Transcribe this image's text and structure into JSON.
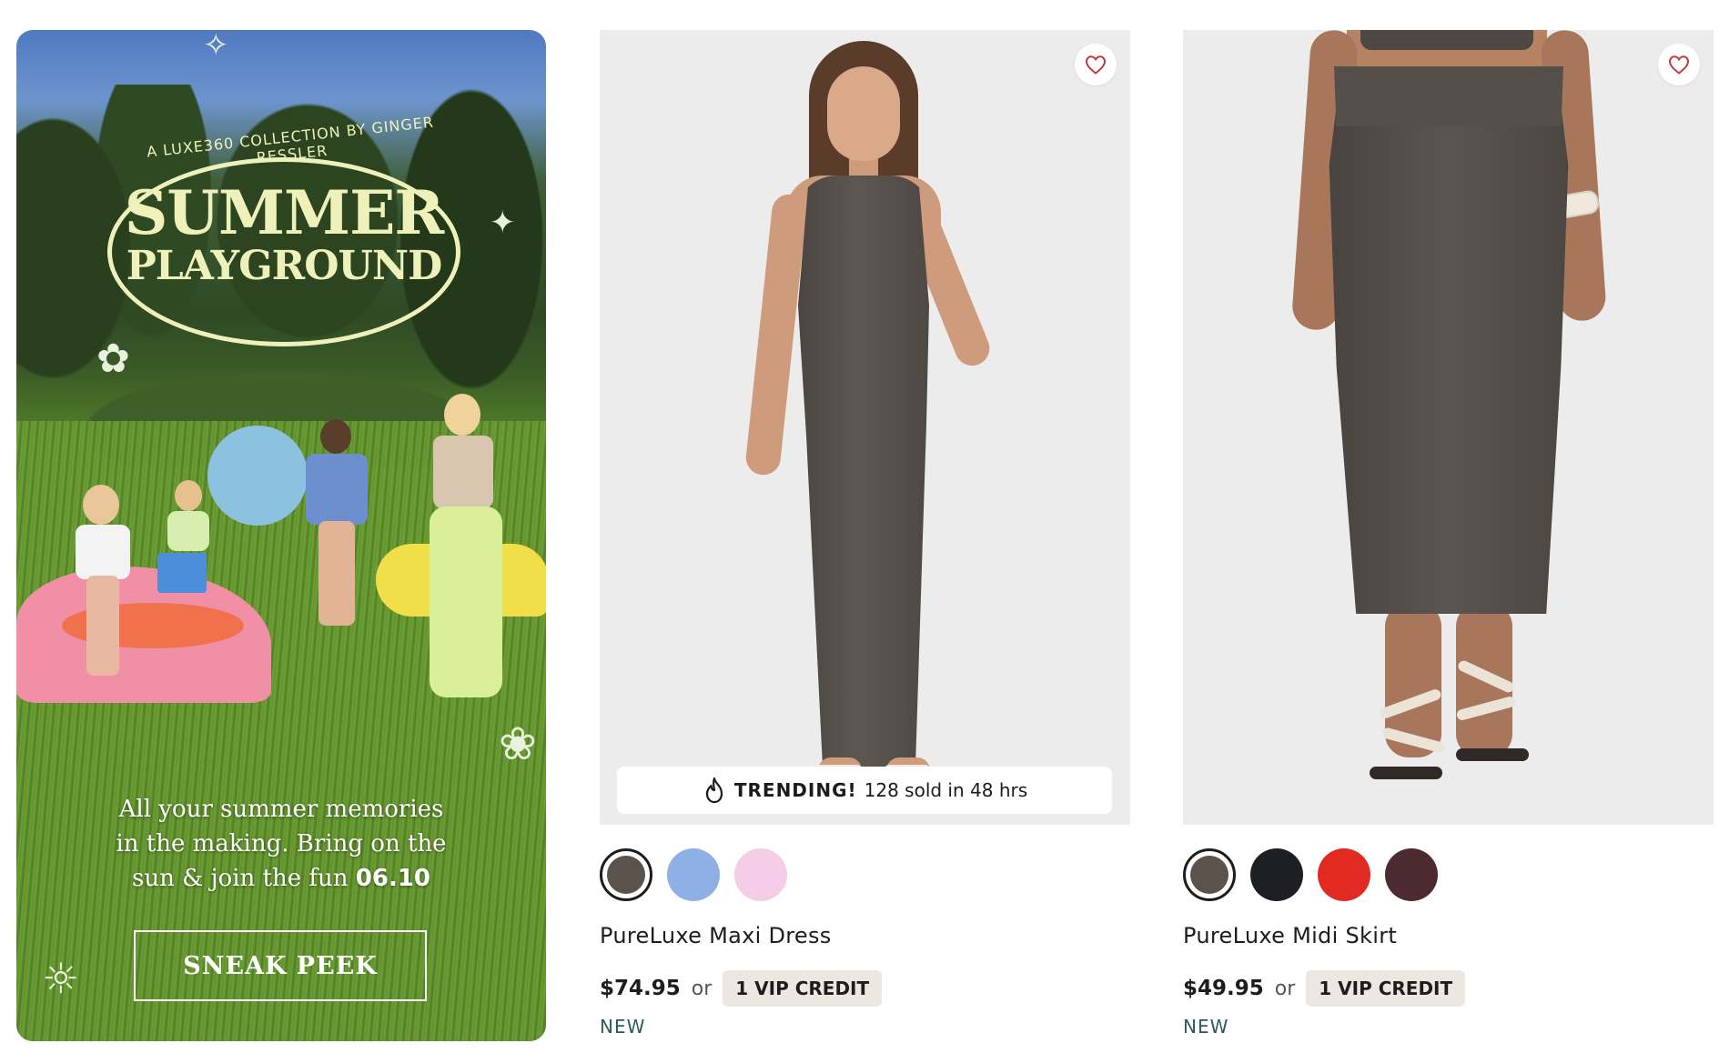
{
  "promo": {
    "arc_text": "A LUXE360 COLLECTION BY GINGER RESSLER",
    "title_line1": "SUMMER",
    "title_line2": "PLAYGROUND",
    "copy_lines": [
      "All your summer memories",
      "in the making. Bring on the",
      "sun & join the fun"
    ],
    "copy_date": "06.10",
    "button_label": "SNEAK PEEK"
  },
  "products": [
    {
      "name": "PureLuxe Maxi Dress",
      "price": "$74.95",
      "or_text": "or",
      "vip_label": "1 VIP CREDIT",
      "badge": "NEW",
      "trending_label": "TRENDING!",
      "trending_text": "128 sold in 48 hrs",
      "swatches": [
        "#5b524c",
        "#8fb0e4",
        "#f5cde6"
      ],
      "selected_swatch": 0
    },
    {
      "name": "PureLuxe Midi Skirt",
      "price": "$49.95",
      "or_text": "or",
      "vip_label": "1 VIP CREDIT",
      "badge": "NEW",
      "swatches": [
        "#5b524c",
        "#1d1f22",
        "#e02a22",
        "#4d2a30"
      ],
      "selected_swatch": 0
    }
  ],
  "icons": {
    "wishlist": "heart-icon",
    "trending": "flame-icon"
  },
  "colors": {
    "heart": "#c0393b",
    "new_badge": "#2c5b5f",
    "vip_bg": "#ece8e1"
  }
}
